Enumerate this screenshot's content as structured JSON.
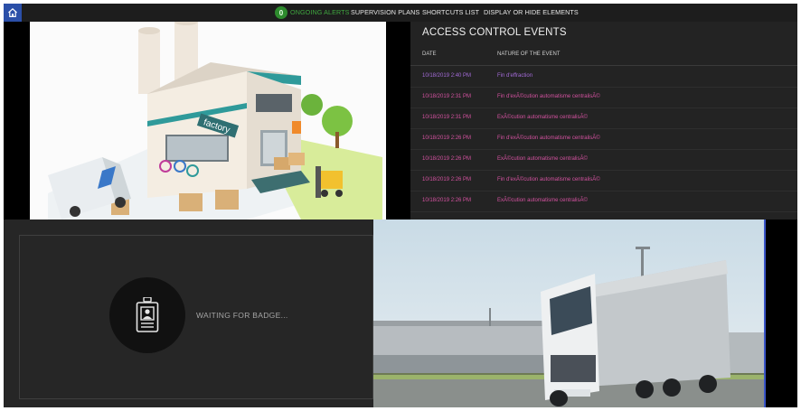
{
  "topbar": {
    "alerts_count": "0",
    "nav": [
      {
        "label": "ONGOING ALERTS"
      },
      {
        "label": "SUPERVISION PLANS"
      },
      {
        "label": "SHORTCUTS LIST"
      },
      {
        "label": "DISPLAY OR HIDE ELEMENTS"
      }
    ]
  },
  "factory": {
    "sign": "factory"
  },
  "events": {
    "title": "ACCESS CONTROL EVENTS",
    "columns": {
      "date": "DATE",
      "nature": "NATURE OF THE EVENT"
    },
    "rows": [
      {
        "date": "10/18/2019 2:40 PM",
        "nature": "Fin d'effraction"
      },
      {
        "date": "10/18/2019 2:31 PM",
        "nature": "Fin d'exÃ©cution automatisme centralisÃ©"
      },
      {
        "date": "10/18/2019 2:31 PM",
        "nature": "ExÃ©cution automatisme centralisÃ©"
      },
      {
        "date": "10/18/2019 2:26 PM",
        "nature": "Fin d'exÃ©cution automatisme centralisÃ©"
      },
      {
        "date": "10/18/2019 2:26 PM",
        "nature": "ExÃ©cution automatisme centralisÃ©"
      },
      {
        "date": "10/18/2019 2:26 PM",
        "nature": "Fin d'exÃ©cution automatisme centralisÃ©"
      },
      {
        "date": "10/18/2019 2:26 PM",
        "nature": "ExÃ©cution automatisme centralisÃ©"
      }
    ]
  },
  "badge": {
    "status": "WAITING FOR BADGE..."
  },
  "colors": {
    "topbar_bg": "#1d1d1d",
    "home_button": "#2b4fa8",
    "alerts_green": "#3fa63f",
    "event_purple": "#a46bd8",
    "event_pink": "#d452a0",
    "panel_dark": "#232323"
  },
  "icons": {
    "home": "home-icon",
    "badge": "id-badge-icon"
  }
}
